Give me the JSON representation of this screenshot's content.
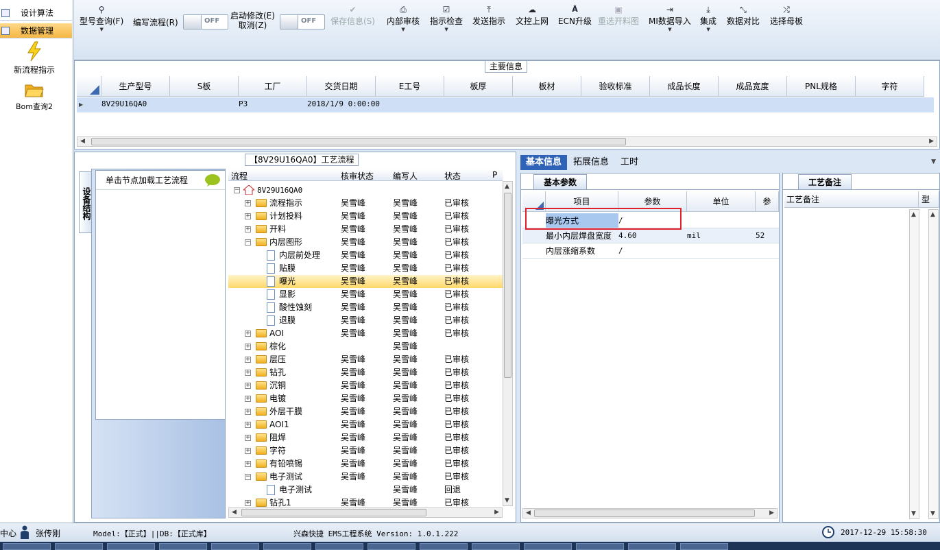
{
  "nav": {
    "head1": "设计算法",
    "head2": "数据管理",
    "entries": [
      "新流程指示",
      "Bom查询2"
    ]
  },
  "toolbar": {
    "model_query": "型号查询(F)",
    "edit_flow": "编写流程(R)",
    "edit_toggle": "OFF",
    "start_modify": "启动修改(E)",
    "cancel": "取消(Z)",
    "start_toggle": "OFF",
    "save_info": "保存信息(S)",
    "internal_review": "内部审核",
    "instruction_check": "指示检查",
    "send_instruction": "发送指示",
    "upload_web": "文控上网",
    "ecn_upgrade": "ECN升级",
    "reselect_cut": "重选开料图",
    "mi_import": "MI数据导入",
    "integrate": "集成",
    "data_compare": "数据对比",
    "select_master": "选择母板"
  },
  "main_info": {
    "title": "主要信息",
    "columns": [
      "生产型号",
      "S板",
      "工厂",
      "交货日期",
      "E工号",
      "板厚",
      "板材",
      "验收标准",
      "成品长度",
      "成品宽度",
      "PNL规格",
      "字符"
    ],
    "row": [
      "8V29U16QA0",
      "",
      "P3",
      "2018/1/9 0:00:00",
      "",
      "",
      "",
      "",
      "",
      "",
      "",
      ""
    ]
  },
  "flow": {
    "title": "【8V29U16QA0】工艺流程",
    "side_tab": "设备结构",
    "hint": "单击节点加载工艺流程",
    "columns": [
      "流程",
      "核审状态",
      "编写人",
      "状态",
      "P"
    ],
    "root": "8V29U16QA0",
    "rows": [
      {
        "name": "流程指示",
        "a": "吴雪峰",
        "b": "吴雪峰",
        "c": "已审核"
      },
      {
        "name": "计划投料",
        "a": "吴雪峰",
        "b": "吴雪峰",
        "c": "已审核"
      },
      {
        "name": "开料",
        "a": "吴雪峰",
        "b": "吴雪峰",
        "c": "已审核"
      },
      {
        "name": "内层图形",
        "a": "吴雪峰",
        "b": "吴雪峰",
        "c": "已审核"
      },
      {
        "name": "内层前处理",
        "a": "吴雪峰",
        "b": "吴雪峰",
        "c": "已审核"
      },
      {
        "name": "贴膜",
        "a": "吴雪峰",
        "b": "吴雪峰",
        "c": "已审核"
      },
      {
        "name": "曝光",
        "a": "吴雪峰",
        "b": "吴雪峰",
        "c": "已审核"
      },
      {
        "name": "显影",
        "a": "吴雪峰",
        "b": "吴雪峰",
        "c": "已审核"
      },
      {
        "name": "酸性蚀刻",
        "a": "吴雪峰",
        "b": "吴雪峰",
        "c": "已审核"
      },
      {
        "name": "退膜",
        "a": "吴雪峰",
        "b": "吴雪峰",
        "c": "已审核"
      },
      {
        "name": "AOI",
        "a": "吴雪峰",
        "b": "吴雪峰",
        "c": "已审核"
      },
      {
        "name": "棕化",
        "a": "",
        "b": "吴雪峰",
        "c": ""
      },
      {
        "name": "层压",
        "a": "吴雪峰",
        "b": "吴雪峰",
        "c": "已审核"
      },
      {
        "name": "钻孔",
        "a": "吴雪峰",
        "b": "吴雪峰",
        "c": "已审核"
      },
      {
        "name": "沉铜",
        "a": "吴雪峰",
        "b": "吴雪峰",
        "c": "已审核"
      },
      {
        "name": "电镀",
        "a": "吴雪峰",
        "b": "吴雪峰",
        "c": "已审核"
      },
      {
        "name": "外层干膜",
        "a": "吴雪峰",
        "b": "吴雪峰",
        "c": "已审核"
      },
      {
        "name": "AOI1",
        "a": "吴雪峰",
        "b": "吴雪峰",
        "c": "已审核"
      },
      {
        "name": "阻焊",
        "a": "吴雪峰",
        "b": "吴雪峰",
        "c": "已审核"
      },
      {
        "name": "字符",
        "a": "吴雪峰",
        "b": "吴雪峰",
        "c": "已审核"
      },
      {
        "name": "有铅喷锡",
        "a": "吴雪峰",
        "b": "吴雪峰",
        "c": "已审核"
      },
      {
        "name": "电子测试",
        "a": "吴雪峰",
        "b": "吴雪峰",
        "c": "已审核"
      },
      {
        "name": "电子测试",
        "a": "",
        "b": "吴雪峰",
        "c": "回退"
      },
      {
        "name": "钻孔1",
        "a": "吴雪峰",
        "b": "吴雪峰",
        "c": "已审核"
      }
    ]
  },
  "info_tabs": [
    "基本信息",
    "拓展信息",
    "工时"
  ],
  "basic": {
    "subtab": "基本参数",
    "columns": [
      "项目",
      "参数",
      "单位",
      "参"
    ],
    "rows": [
      {
        "name": "曝光方式",
        "value": "/",
        "unit": "",
        "p": ""
      },
      {
        "name": "最小内层焊盘宽度",
        "value": "4.60",
        "unit": "mil",
        "p": "52"
      },
      {
        "name": "内层涨缩系数",
        "value": "/",
        "unit": "",
        "p": ""
      }
    ]
  },
  "remark": {
    "subtab": "工艺备注",
    "col1": "工艺备注",
    "col2": "型"
  },
  "status": {
    "center": "中心",
    "user": "张传刚",
    "db": "Model:【正式】||DB:【正式库】",
    "app": "兴森快捷 EMS工程系统 Version: 1.0.1.222",
    "time": "2017-12-29 15:58:30"
  }
}
